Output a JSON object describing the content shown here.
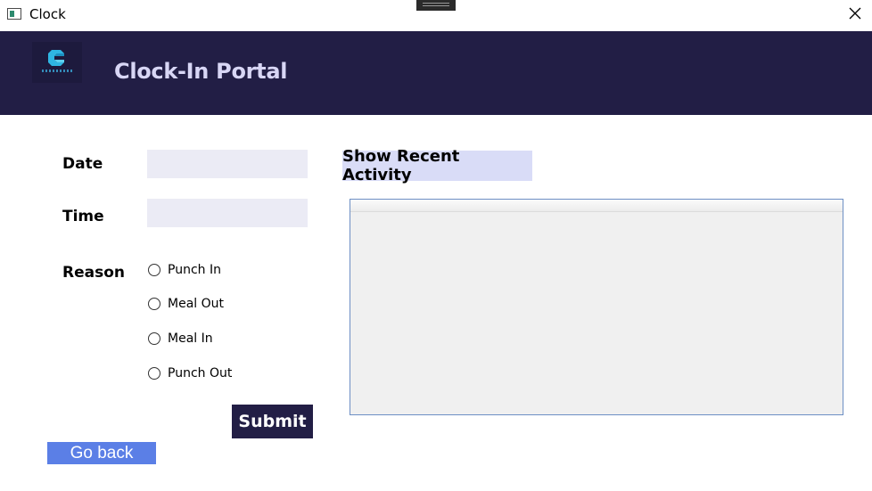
{
  "window": {
    "title": "Clock"
  },
  "header": {
    "title": "Clock-In Portal"
  },
  "form": {
    "date_label": "Date",
    "date_value": "",
    "time_label": "Time",
    "time_value": "",
    "reason_label": "Reason",
    "reasons": [
      {
        "label": "Punch In",
        "selected": false
      },
      {
        "label": "Meal Out",
        "selected": false
      },
      {
        "label": "Meal In",
        "selected": false
      },
      {
        "label": "Punch Out",
        "selected": false
      }
    ],
    "submit_label": "Submit"
  },
  "activity": {
    "button_label": "Show Recent Activity",
    "rows": []
  },
  "nav": {
    "go_back_label": "Go back"
  },
  "colors": {
    "header_bg": "#221e45",
    "header_text": "#d8d6f5",
    "input_bg": "#ebebf5",
    "go_back_bg": "#5b7fe6",
    "activity_button_bg": "#d9dcf7",
    "panel_border": "#6d8fc4"
  },
  "icons": {
    "app": "window-app-icon",
    "close": "close-icon",
    "logo": "company-logo"
  }
}
